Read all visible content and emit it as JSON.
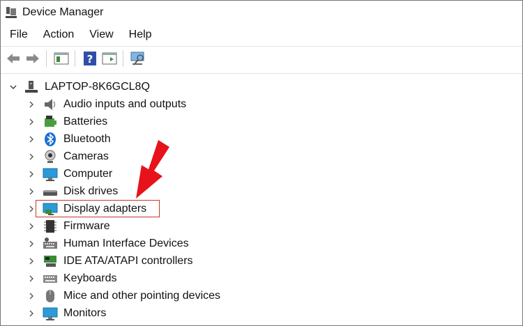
{
  "window": {
    "title": "Device Manager"
  },
  "menu": [
    "File",
    "Action",
    "View",
    "Help"
  ],
  "toolbar": {
    "buttons": [
      "back-icon",
      "forward-icon",
      "show-hide-console-tree-icon",
      "help-icon",
      "properties-icon",
      "scan-hardware-icon"
    ]
  },
  "tree": {
    "root": "LAPTOP-8K6GCL8Q",
    "categories": [
      "Audio inputs and outputs",
      "Batteries",
      "Bluetooth",
      "Cameras",
      "Computer",
      "Disk drives",
      "Display adapters",
      "Firmware",
      "Human Interface Devices",
      "IDE ATA/ATAPI controllers",
      "Keyboards",
      "Mice and other pointing devices",
      "Monitors"
    ],
    "highlighted": "Display adapters"
  },
  "colors": {
    "highlight": "#c0392b",
    "arrow": "#e8121a"
  }
}
